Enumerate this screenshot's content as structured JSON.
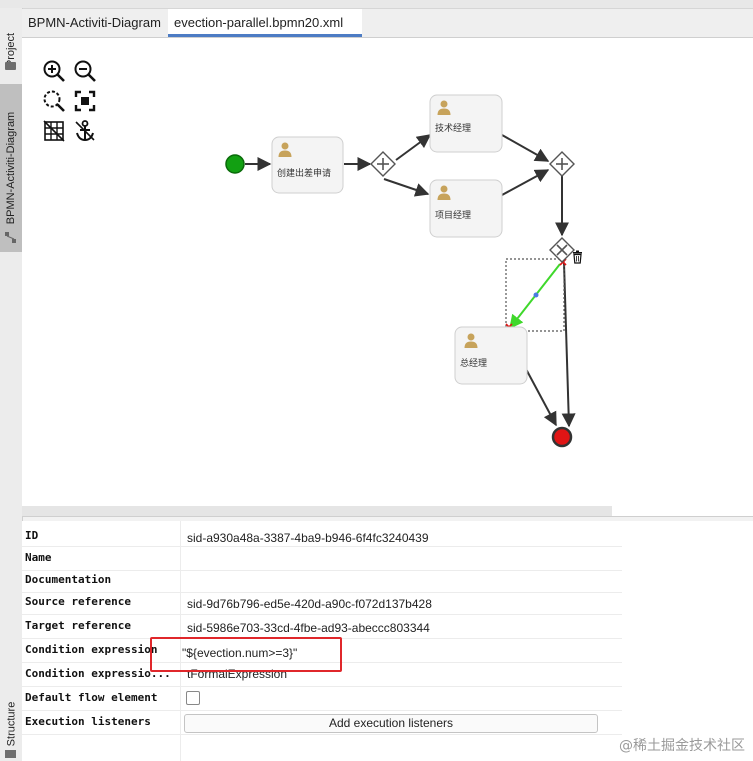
{
  "side_panel": {
    "tabs": [
      {
        "label": "Project",
        "icon": "folder-icon"
      },
      {
        "label": "BPMN-Activiti-Diagram",
        "icon": "diagram-icon"
      },
      {
        "label": "Structure",
        "icon": "structure-icon"
      }
    ]
  },
  "editor_tabs": [
    {
      "label": "BPMN-Activiti-Diagram"
    },
    {
      "label": "evection-parallel.bpmn20.xml"
    }
  ],
  "toolbar": {
    "icons": [
      "zoom-in-icon",
      "zoom-out-icon",
      "zoom-actual-icon",
      "fit-to-screen-icon",
      "grid-icon",
      "anchor-icon"
    ]
  },
  "diagram": {
    "tasks": [
      {
        "id": "task-create",
        "label": "创建出差申请"
      },
      {
        "id": "task-tech-manager",
        "label": "技术经理"
      },
      {
        "id": "task-project-manager",
        "label": "项目经理"
      },
      {
        "id": "task-general-manager",
        "label": "总经理"
      }
    ],
    "colors": {
      "start_event": "#12a012",
      "end_event": "#e01515",
      "selected_flow": "#3fd82b",
      "task_icon": "#c7a35b"
    }
  },
  "properties": {
    "rows": [
      {
        "key": "ID",
        "value": "sid-a930a48a-3387-4ba9-b946-6f4fc3240439"
      },
      {
        "key": "Name",
        "value": ""
      },
      {
        "key": "Documentation",
        "value": ""
      },
      {
        "key": "Source reference",
        "value": "sid-9d76b796-ed5e-420d-a90c-f072d137b428"
      },
      {
        "key": "Target reference",
        "value": "sid-5986e703-33cd-4fbe-ad93-abeccc803344"
      },
      {
        "key": "Condition expression",
        "value": "\"${evection.num>=3}\""
      },
      {
        "key": "Condition expressio...",
        "value": "tFormalExpression"
      },
      {
        "key": "Default flow element",
        "value": ""
      },
      {
        "key": "Execution listeners",
        "value": ""
      }
    ],
    "add_listener_button": "Add execution listeners",
    "highlight_color": "#e0272b"
  },
  "watermark": "@稀土掘金技术社区"
}
